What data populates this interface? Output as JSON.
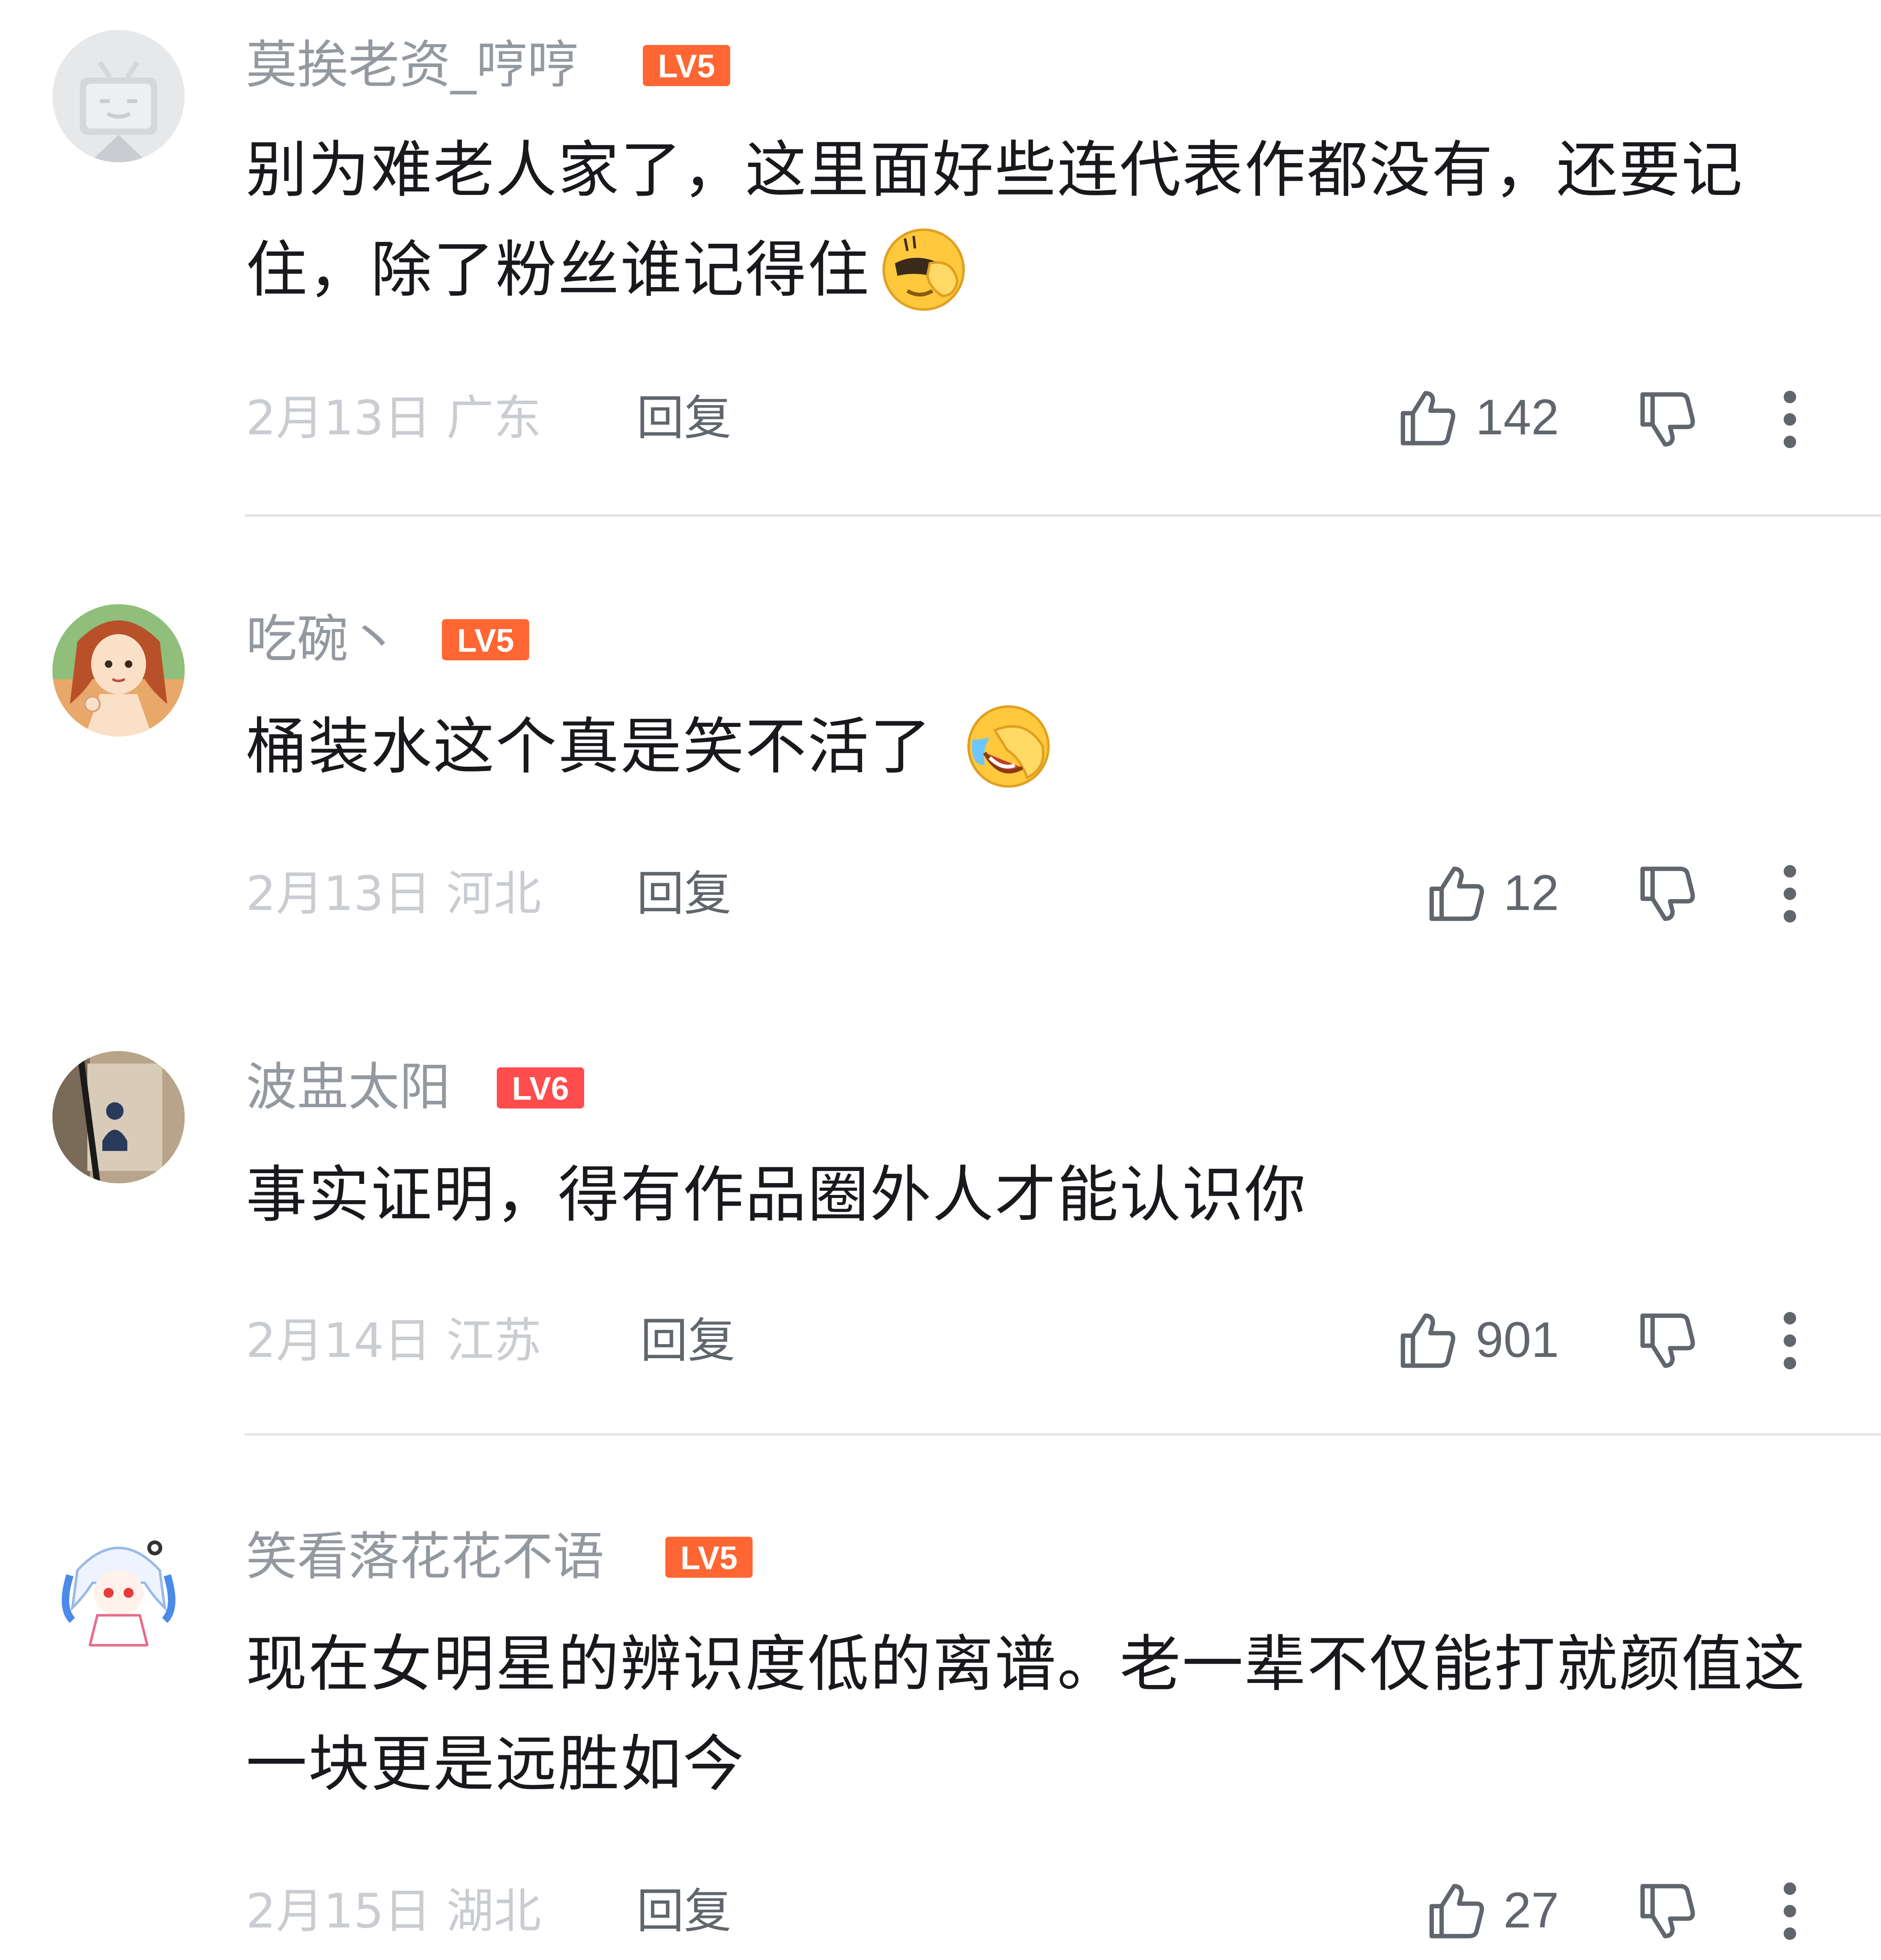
{
  "comments": [
    {
      "username": "莫挨老资_哼哼",
      "level": "LV5",
      "content": "别为难老人家了，这里面好些连代表作都没有，还要记住，除了粉丝谁记得住",
      "emoji": "facepalm-emoji",
      "date": "2月13日",
      "location": "广东",
      "reply_label": "回复",
      "likes": "142"
    },
    {
      "username": "吃碗丶",
      "level": "LV5",
      "content": "桶装水这个真是笑不活了",
      "emoji": "laughing-crying-emoji",
      "date": "2月13日",
      "location": "河北",
      "reply_label": "回复",
      "likes": "12"
    },
    {
      "username": "波盅太阳",
      "level": "LV6",
      "content": "事实证明，得有作品圈外人才能认识你",
      "date": "2月14日",
      "location": "江苏",
      "reply_label": "回复",
      "likes": "901"
    },
    {
      "username": "笑看落花花不语",
      "level": "LV5",
      "content": "现在女明星的辨识度低的离谱。老一辈不仅能打就颜值这一块更是远胜如今",
      "date": "2月15日",
      "location": "湖北",
      "reply_label": "回复",
      "likes": "27"
    }
  ],
  "colors": {
    "username": "#9499a0",
    "content": "#18191c",
    "meta": "#c9ccd0",
    "level_badge": "#ff6633",
    "divider": "#e3e5e7"
  },
  "icons": {
    "like": "thumbs-up-icon",
    "dislike": "thumbs-down-icon",
    "more": "more-vertical-icon"
  }
}
